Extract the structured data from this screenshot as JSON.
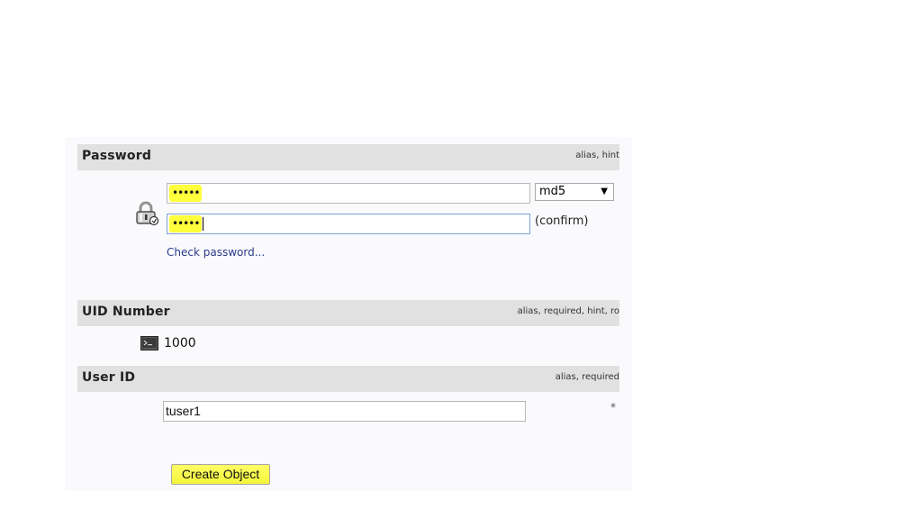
{
  "password_section": {
    "title": "Password",
    "meta": "alias, hint",
    "password_mask": "•••••",
    "confirm_mask": "•••••",
    "hash_select": {
      "selected": "md5"
    },
    "confirm_label": "(confirm)",
    "check_password_link": "Check password...",
    "icon": "padlock-icon"
  },
  "uid_section": {
    "title": "UID Number",
    "meta": "alias, required, hint, ro",
    "value": "1000",
    "icon": "terminal-icon"
  },
  "user_id_section": {
    "title": "User ID",
    "meta": "alias, required",
    "input_value": "tuser1",
    "required_marker": "*"
  },
  "create_button": {
    "label": "Create Object"
  },
  "colors": {
    "highlight": "#ffff3c",
    "header_bg": "#e1e1e1",
    "link": "#2b3a8a",
    "focus_border": "#7da2ce"
  }
}
